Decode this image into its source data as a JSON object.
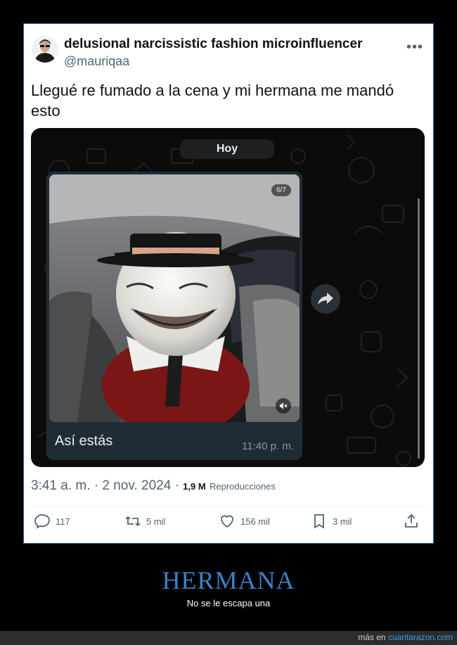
{
  "tweet": {
    "author_name": "delusional narcissistic fashion microinfluencer",
    "handle": "@mauriqaa",
    "more_icon": "ellipsis-icon",
    "text": "Llegué re fumado a la cena y mi hermana me mandó esto",
    "time": "3:41 a. m. · 2 nov. 2024",
    "views_count": "1,9 M",
    "views_label": "Reproducciones"
  },
  "chat": {
    "day_label": "Hoy",
    "media_counter": "6/7",
    "caption": "Así estás",
    "message_time": "11:40 p. m.",
    "forward_icon": "forward-icon",
    "mute_icon": "mute-icon"
  },
  "actions": {
    "replies": "117",
    "retweets": "5 mil",
    "likes": "156 mil",
    "bookmarks": "3 mil"
  },
  "page": {
    "title": "HERMANA",
    "subtitle": "No se le escapa una",
    "footer_prefix": "más en",
    "footer_link": "cuantarazon.com"
  },
  "colors": {
    "accent": "#3a82c8",
    "text_secondary": "#536471",
    "chat_bubble": "#202c33"
  }
}
